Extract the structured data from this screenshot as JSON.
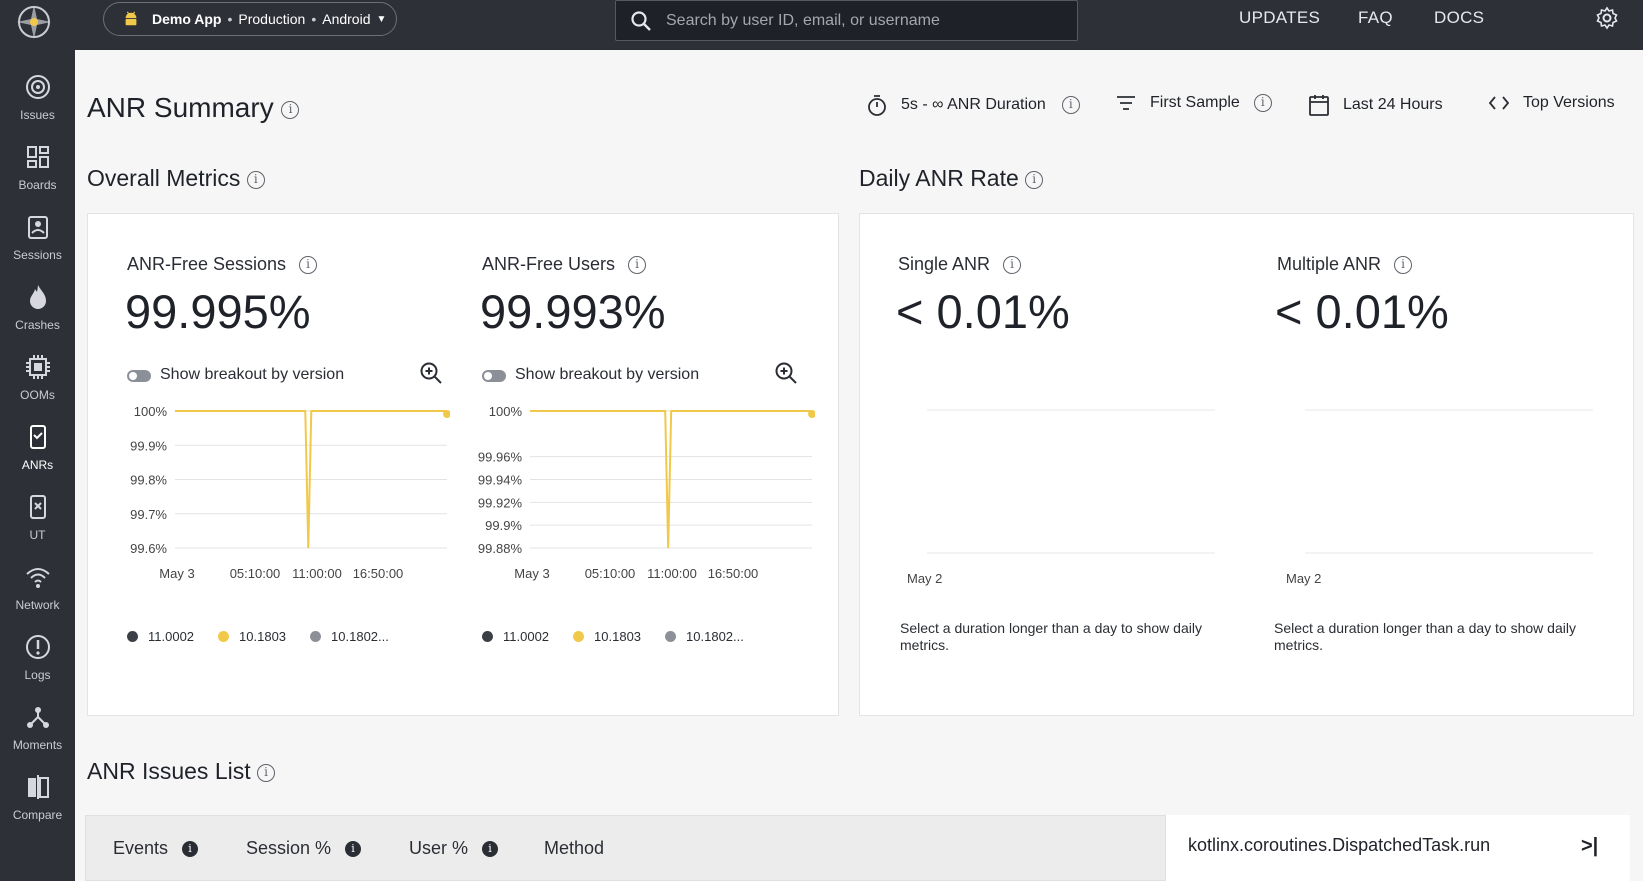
{
  "sidebar": {
    "items": [
      {
        "label": "Issues",
        "icon": "issues-icon"
      },
      {
        "label": "Boards",
        "icon": "boards-icon"
      },
      {
        "label": "Sessions",
        "icon": "sessions-icon"
      },
      {
        "label": "Crashes",
        "icon": "crashes-icon"
      },
      {
        "label": "OOMs",
        "icon": "ooms-icon"
      },
      {
        "label": "ANRs",
        "icon": "anrs-icon",
        "active": true
      },
      {
        "label": "UT",
        "icon": "ut-icon"
      },
      {
        "label": "Network",
        "icon": "network-icon"
      },
      {
        "label": "Logs",
        "icon": "logs-icon"
      },
      {
        "label": "Moments",
        "icon": "moments-icon"
      },
      {
        "label": "Compare",
        "icon": "compare-icon"
      }
    ]
  },
  "topbar": {
    "app_name": "Demo App",
    "environment": "Production",
    "platform": "Android",
    "search_placeholder": "Search by user ID, email, or username",
    "links": {
      "updates": "UPDATES",
      "faq": "FAQ",
      "docs": "DOCS"
    }
  },
  "header": {
    "title": "ANR Summary",
    "filters": {
      "duration": "5s - ∞ ANR Duration",
      "sample": "First Sample",
      "range": "Last 24 Hours",
      "versions": "Top Versions"
    }
  },
  "overall_metrics": {
    "title": "Overall Metrics",
    "sessions": {
      "label": "ANR-Free Sessions",
      "value": "99.995%",
      "toggle_label": "Show breakout by version"
    },
    "users": {
      "label": "ANR-Free Users",
      "value": "99.993%",
      "toggle_label": "Show breakout by version"
    }
  },
  "daily_rate": {
    "title": "Daily ANR Rate",
    "single": {
      "label": "Single ANR",
      "value": "< 0.01%",
      "date": "May 2",
      "hint": "Select a duration longer than a day to show daily metrics."
    },
    "multiple": {
      "label": "Multiple ANR",
      "value": "< 0.01%",
      "date": "May 2",
      "hint": "Select a duration longer than a day to show daily metrics."
    }
  },
  "issues": {
    "title": "ANR Issues List",
    "columns": {
      "events": "Events",
      "session": "Session %",
      "user": "User %",
      "method": "Method"
    },
    "detail_title": "kotlinx.coroutines.DispatchedTask.run",
    "collapse_label": ">|"
  },
  "colors": {
    "accent_yellow": "#f1c94a",
    "dark": "#2e3038",
    "legend_dark": "#3b3f46",
    "legend_gray": "#8d9097"
  },
  "chart_data": [
    {
      "type": "line",
      "title": "ANR-Free Sessions",
      "x": [
        "May 3",
        "05:10:00",
        "11:00:00",
        "16:50:00"
      ],
      "yticks": [
        "99.6%",
        "99.7%",
        "99.8%",
        "99.9%",
        "100%"
      ],
      "ylim": [
        99.6,
        100
      ],
      "series": [
        {
          "name": "11.0002",
          "color": "#3b3f46",
          "values": []
        },
        {
          "name": "10.1803",
          "color": "#f1c94a",
          "values": [
            100,
            100,
            100,
            99.6,
            100,
            100,
            100,
            100
          ]
        },
        {
          "name": "10.1802...",
          "color": "#8d9097",
          "values": []
        }
      ]
    },
    {
      "type": "line",
      "title": "ANR-Free Users",
      "x": [
        "May 3",
        "05:10:00",
        "11:00:00",
        "16:50:00"
      ],
      "yticks": [
        "99.88%",
        "99.9%",
        "99.92%",
        "99.94%",
        "99.96%",
        "100%"
      ],
      "ylim": [
        99.88,
        100
      ],
      "series": [
        {
          "name": "11.0002",
          "color": "#3b3f46",
          "values": []
        },
        {
          "name": "10.1803",
          "color": "#f1c94a",
          "values": [
            100,
            100,
            100,
            99.88,
            100,
            100,
            100,
            100
          ]
        },
        {
          "name": "10.1802...",
          "color": "#8d9097",
          "values": []
        }
      ]
    }
  ]
}
